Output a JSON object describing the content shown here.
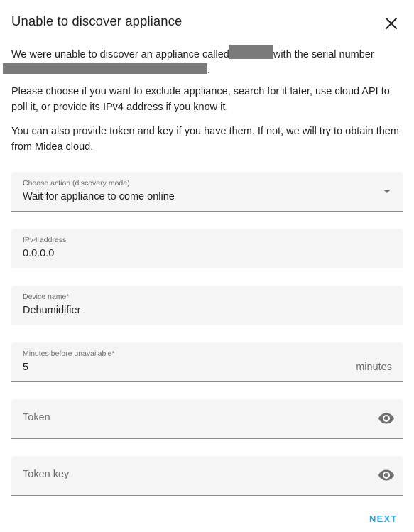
{
  "dialog": {
    "title": "Unable to discover appliance",
    "intro_before": "We were unable to discover an appliance called",
    "intro_middle": "with the serial number",
    "intro_after": ".",
    "paragraph_2": "Please choose if you want to exclude appliance, search for it later, use cloud API to poll it, or provide its IPv4 address if you know it.",
    "paragraph_3": "You can also provide token and key if you have them. If not, we will try to obtain them from Midea cloud."
  },
  "form": {
    "action": {
      "label": "Choose action (discovery mode)",
      "value": "Wait for appliance to come online"
    },
    "ip": {
      "label": "IPv4 address",
      "value": "0.0.0.0"
    },
    "name": {
      "label": "Device name*",
      "value": "Dehumidifier"
    },
    "minutes": {
      "label": "Minutes before unavailable*",
      "value": "5",
      "suffix": "minutes"
    },
    "token": {
      "placeholder": "Token"
    },
    "token_key": {
      "placeholder": "Token key"
    }
  },
  "actions": {
    "next_label": "NEXT"
  },
  "icons": {
    "close": "close-icon",
    "dropdown": "chevron-down-icon",
    "visibility": "eye-icon"
  },
  "colors": {
    "accent": "#2ea3dc",
    "field_bg": "#f5f5f5",
    "redaction": "#7a7a7a"
  }
}
